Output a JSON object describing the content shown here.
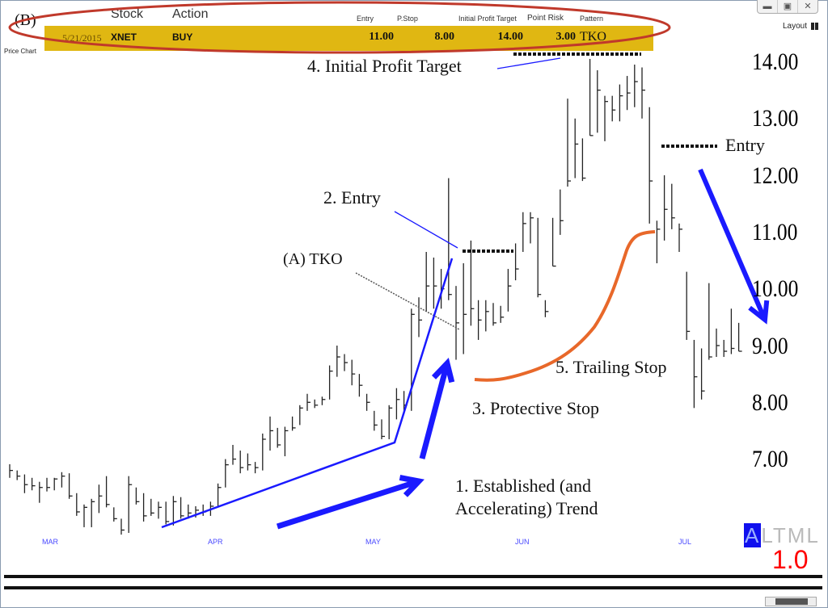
{
  "window": {
    "controls": [
      "minimize",
      "restore",
      "close"
    ],
    "layout_label": "Layout",
    "panel_label": "Price Chart"
  },
  "header": {
    "columns": {
      "stock": "Stock",
      "action": "Action",
      "entry": "Entry",
      "pstop": "P.Stop",
      "target": "Initial Profit Target",
      "risk": "Point Risk",
      "pattern": "Pattern"
    },
    "row": {
      "date": "5/21/2015",
      "stock": "XNET",
      "action": "BUY",
      "entry": "11.00",
      "pstop": "8.00",
      "target": "14.00",
      "risk": "3.00",
      "pattern": "TKO"
    },
    "row_color": "#e0b712"
  },
  "annotations": {
    "b": "(B)",
    "profit_target": "4. Initial Profit Target",
    "entry": "2. Entry",
    "tko": "(A) TKO",
    "entry_right": "Entry",
    "trailing_stop": "5. Trailing Stop",
    "protective_stop": "3. Protective Stop",
    "trend_line1": "1. Established (and",
    "trend_line2": "Accelerating) Trend",
    "arrow_color": "#1a1aff",
    "ellipse_color": "#c0392b",
    "trailing_color": "#e8682a"
  },
  "footer": {
    "altml_first": "A",
    "altml_rest": "LTML",
    "version": "1.0",
    "version_color": "#ff0000"
  },
  "chart_data": {
    "type": "ohlc",
    "y_ticks": [
      "14.00",
      "13.00",
      "12.00",
      "11.00",
      "10.00",
      "9.00",
      "8.00",
      "7.00"
    ],
    "ylim": [
      7,
      14
    ],
    "x_ticks": [
      "MAR",
      "APR",
      "MAY",
      "JUN",
      "JUL"
    ],
    "levels": {
      "profit_target": 14.0,
      "entry": 11.0,
      "second_entry": 12.0
    },
    "bars_hlc": [
      [
        6.96,
        6.72,
        6.85
      ],
      [
        6.85,
        6.68,
        6.75
      ],
      [
        6.78,
        6.45,
        6.6
      ],
      [
        6.72,
        6.5,
        6.58
      ],
      [
        6.65,
        6.28,
        6.55
      ],
      [
        6.72,
        6.48,
        6.55
      ],
      [
        6.72,
        6.5,
        6.7
      ],
      [
        6.82,
        6.55,
        6.75
      ],
      [
        6.8,
        6.35,
        6.4
      ],
      [
        6.45,
        6.05,
        6.12
      ],
      [
        6.25,
        5.85,
        6.2
      ],
      [
        6.35,
        5.85,
        6.3
      ],
      [
        6.6,
        6.1,
        6.4
      ],
      [
        6.75,
        6.2,
        6.25
      ],
      [
        6.2,
        5.95,
        6.0
      ],
      [
        6.0,
        5.72,
        5.8
      ],
      [
        6.75,
        5.75,
        6.6
      ],
      [
        6.55,
        6.25,
        6.3
      ],
      [
        6.45,
        5.95,
        6.05
      ],
      [
        6.35,
        6.05,
        6.1
      ],
      [
        6.3,
        6.0,
        6.2
      ],
      [
        6.3,
        5.9,
        5.95
      ],
      [
        6.4,
        5.88,
        6.3
      ],
      [
        6.38,
        6.0,
        6.05
      ],
      [
        6.25,
        6.0,
        6.1
      ],
      [
        6.22,
        6.02,
        6.15
      ],
      [
        6.25,
        6.05,
        6.12
      ],
      [
        6.3,
        6.05,
        6.22
      ],
      [
        6.62,
        6.2,
        6.55
      ],
      [
        7.05,
        6.55,
        6.95
      ],
      [
        7.3,
        6.95,
        7.05
      ],
      [
        7.2,
        6.8,
        6.9
      ],
      [
        7.15,
        6.85,
        6.95
      ],
      [
        7.0,
        6.8,
        6.9
      ],
      [
        7.5,
        6.85,
        7.4
      ],
      [
        7.8,
        7.2,
        7.55
      ],
      [
        7.6,
        7.25,
        7.3
      ],
      [
        7.62,
        7.1,
        7.55
      ],
      [
        7.8,
        7.55,
        7.6
      ],
      [
        8.0,
        7.65,
        7.95
      ],
      [
        8.2,
        7.9,
        8.05
      ],
      [
        8.1,
        7.95,
        8.0
      ],
      [
        8.15,
        8.0,
        8.1
      ],
      [
        8.7,
        8.1,
        8.6
      ],
      [
        9.05,
        8.5,
        8.85
      ],
      [
        8.9,
        8.6,
        8.75
      ],
      [
        8.8,
        8.35,
        8.55
      ],
      [
        8.55,
        8.15,
        8.35
      ],
      [
        8.2,
        7.9,
        8.05
      ],
      [
        7.9,
        7.55,
        7.65
      ],
      [
        7.75,
        7.4,
        7.45
      ],
      [
        8.0,
        7.4,
        7.95
      ],
      [
        8.3,
        7.75,
        8.1
      ],
      [
        8.25,
        7.85,
        8.0
      ],
      [
        9.7,
        7.9,
        9.6
      ],
      [
        9.9,
        9.2,
        9.5
      ],
      [
        10.7,
        9.65,
        10.1
      ],
      [
        10.6,
        9.7,
        10.1
      ],
      [
        10.4,
        9.7,
        10.05
      ],
      [
        12.0,
        9.85,
        9.95
      ],
      [
        10.1,
        8.8,
        9.45
      ],
      [
        10.5,
        8.9,
        9.6
      ],
      [
        10.9,
        9.4,
        9.7
      ],
      [
        9.85,
        9.15,
        9.5
      ],
      [
        9.85,
        9.3,
        9.65
      ],
      [
        9.8,
        9.4,
        9.45
      ],
      [
        9.75,
        9.45,
        9.55
      ],
      [
        10.4,
        9.65,
        10.1
      ],
      [
        10.85,
        10.2,
        10.4
      ],
      [
        11.4,
        10.7,
        11.2
      ],
      [
        11.4,
        10.85,
        11.3
      ],
      [
        11.3,
        9.9,
        9.95
      ],
      [
        9.85,
        9.55,
        9.65
      ],
      [
        11.3,
        10.45,
        10.45
      ],
      [
        11.8,
        11.0,
        11.25
      ],
      [
        13.4,
        11.85,
        11.95
      ],
      [
        13.05,
        12.0,
        12.6
      ],
      [
        12.7,
        11.95,
        12.0
      ],
      [
        14.1,
        12.75,
        12.75
      ],
      [
        13.9,
        12.8,
        13.55
      ],
      [
        13.45,
        12.65,
        13.35
      ],
      [
        13.45,
        13.0,
        13.2
      ],
      [
        13.65,
        13.0,
        13.45
      ],
      [
        13.8,
        13.2,
        13.5
      ],
      [
        14.0,
        13.25,
        13.7
      ],
      [
        13.95,
        13.05,
        13.55
      ],
      [
        13.25,
        11.2,
        11.95
      ],
      [
        11.25,
        10.5,
        11.1
      ],
      [
        12.05,
        10.9,
        11.45
      ],
      [
        11.9,
        11.1,
        11.3
      ],
      [
        11.2,
        10.7,
        11.1
      ],
      [
        10.35,
        9.15,
        9.3
      ],
      [
        9.15,
        7.95,
        8.5
      ],
      [
        9.0,
        8.1,
        8.25
      ],
      [
        10.15,
        8.8,
        8.85
      ],
      [
        9.35,
        8.85,
        9.05
      ],
      [
        9.15,
        8.85,
        8.95
      ],
      [
        9.7,
        8.9,
        9.0
      ],
      [
        9.45,
        8.95,
        8.95
      ]
    ]
  }
}
